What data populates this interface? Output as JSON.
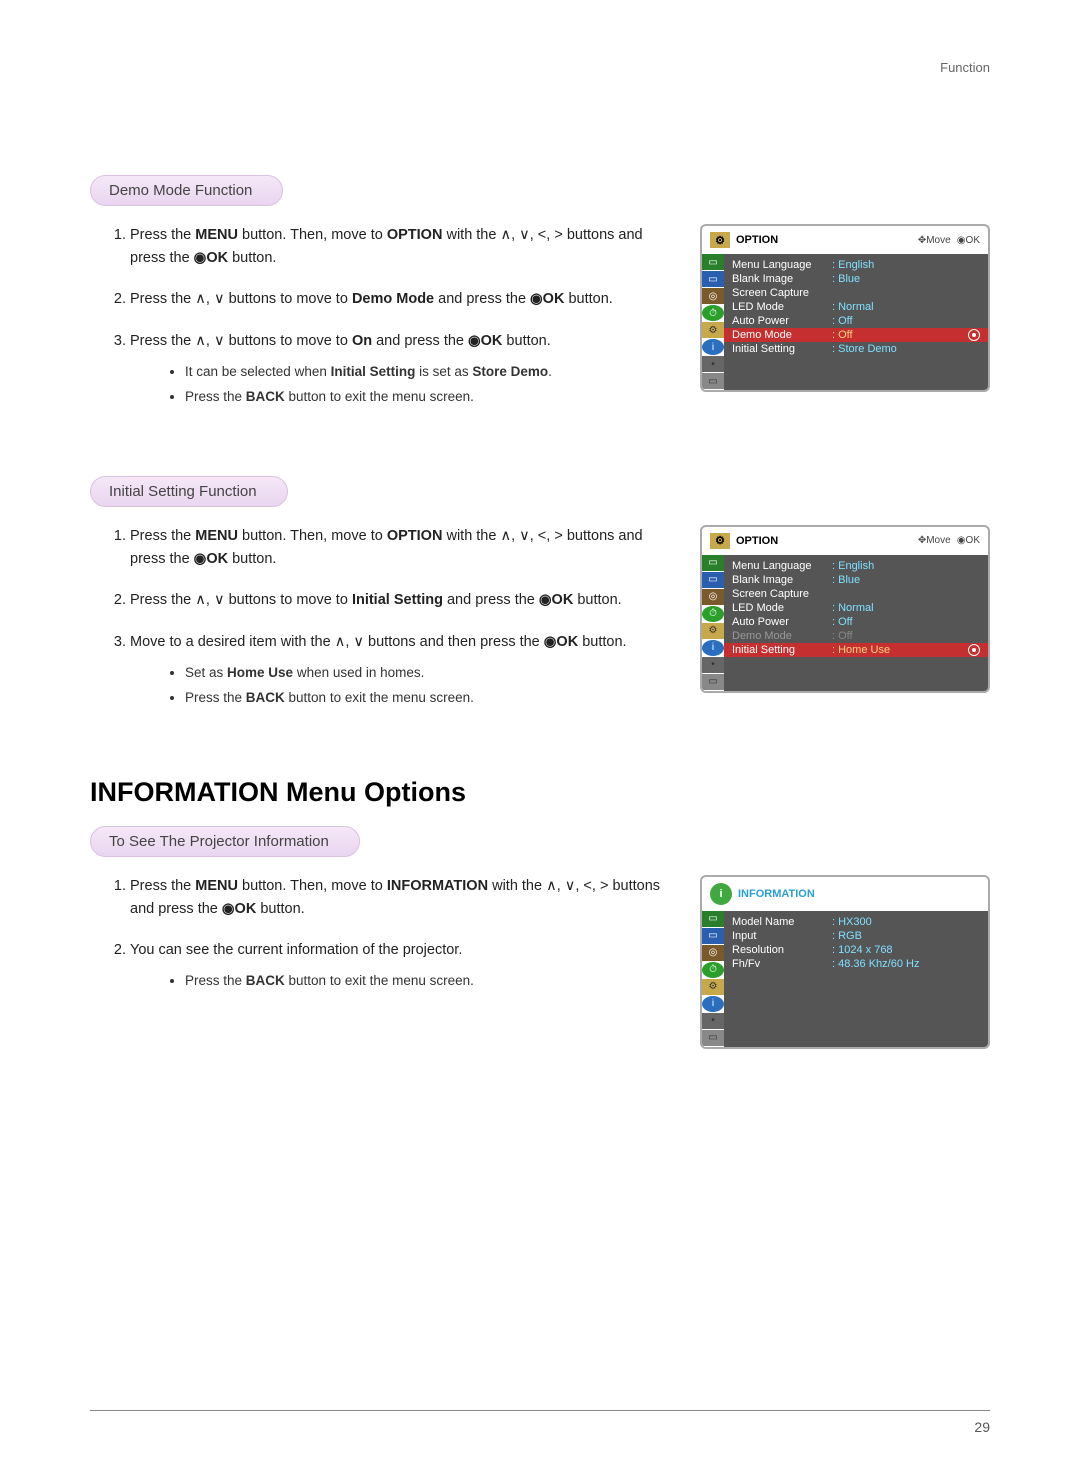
{
  "header": {
    "category": "Function"
  },
  "sections": {
    "demo": {
      "pill": "Demo Mode Function",
      "step1_a": "Press the ",
      "step1_menu": "MENU",
      "step1_b": " button. Then, move to ",
      "step1_option": "OPTION",
      "step1_c": " with the ",
      "step1_nav": "∧, ∨, <, >",
      "step1_d": " buttons and press the ",
      "step1_ok": "◉OK",
      "step1_e": " button.",
      "step2_a": "Press the ",
      "step2_nav": "∧, ∨",
      "step2_b": " buttons to move to ",
      "step2_target": "Demo Mode",
      "step2_c": " and press the ",
      "step2_ok": "◉OK",
      "step2_d": " button.",
      "step3_a": "Press the ",
      "step3_nav": "∧, ∨",
      "step3_b": " buttons to move to ",
      "step3_on": "On",
      "step3_c": " and press the ",
      "step3_ok": "◉OK",
      "step3_d": " button.",
      "bullet1_a": "It can be selected when ",
      "bullet1_b": "Initial Setting",
      "bullet1_c": " is set as ",
      "bullet1_d": "Store Demo",
      "bullet1_e": ".",
      "bullet2_a": "Press the ",
      "bullet2_b": "BACK",
      "bullet2_c": " button to exit the menu screen."
    },
    "initial": {
      "pill": "Initial Setting Function",
      "step1_a": "Press the ",
      "step1_menu": "MENU",
      "step1_b": " button. Then, move to ",
      "step1_option": "OPTION",
      "step1_c": " with the ",
      "step1_nav": "∧, ∨, <, >",
      "step1_d": "   buttons and press the ",
      "step1_ok": "◉OK",
      "step1_e": " button.",
      "step2_a": "Press the ",
      "step2_nav": "∧, ∨",
      "step2_b": " buttons to move to ",
      "step2_target": "Initial Setting",
      "step2_c": " and press the ",
      "step2_ok": "◉OK",
      "step2_d": " button.",
      "step3_a": "Move to a desired item with the ",
      "step3_nav": "∧, ∨",
      "step3_b": "  buttons and then press the ",
      "step3_ok": "◉OK",
      "step3_c": " button.",
      "bullet1_a": "Set as ",
      "bullet1_b": "Home Use",
      "bullet1_c": " when used in homes.",
      "bullet2_a": "Press the ",
      "bullet2_b": "BACK",
      "bullet2_c": " button to exit the menu screen."
    },
    "info": {
      "heading": "INFORMATION Menu Options",
      "pill": "To See The Projector Information",
      "step1_a": "Press the ",
      "step1_menu": "MENU",
      "step1_b": " button. Then, move to ",
      "step1_info": "INFORMATION",
      "step1_c": " with the ",
      "step1_nav": "∧, ∨, <, >",
      "step1_d": " buttons and press the ",
      "step1_ok": "◉OK",
      "step1_e": " button.",
      "step2": "You can see the current information of the projector.",
      "bullet1_a": "Press the ",
      "bullet1_b": "BACK",
      "bullet1_c": " button to exit the menu screen."
    }
  },
  "osd_option": {
    "title": "OPTION",
    "hint_move": "✥Move",
    "hint_ok": "◉OK",
    "rows": {
      "menu_lang_label": "Menu Language",
      "menu_lang_value": ": English",
      "blank_label": "Blank Image",
      "blank_value": ": Blue",
      "screen_cap": "Screen Capture",
      "led_label": "LED Mode",
      "led_value": ": Normal",
      "auto_label": "Auto Power",
      "auto_value": ": Off",
      "demo_label": "Demo Mode",
      "demo_value": ": Off",
      "initial_label": "Initial Setting",
      "initial_value_store": ": Store Demo",
      "initial_value_home": ": Home Use"
    }
  },
  "osd_info": {
    "title": "INFORMATION",
    "rows": {
      "model_label": "Model Name",
      "model_value": ": HX300",
      "input_label": "Input",
      "input_value": ": RGB",
      "res_label": "Resolution",
      "res_value": ": 1024 x 768",
      "fh_label": "Fh/Fv",
      "fh_value": ": 48.36 Khz/60 Hz"
    }
  },
  "page_number": "29"
}
